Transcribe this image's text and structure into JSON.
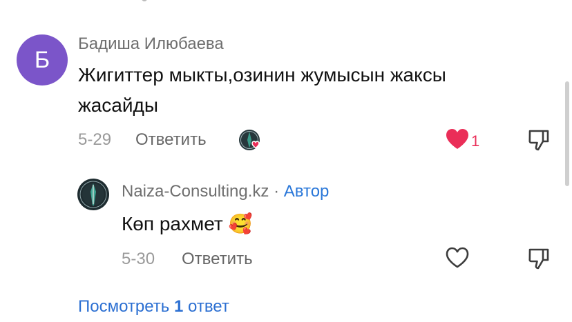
{
  "comment": {
    "avatar_letter": "Б",
    "author": "Бадиша Илюбаева",
    "text_line1": "Жигиттер мыкты,озинин жумысын жаксы",
    "text_line2": "жасайды",
    "date": "5-29",
    "reply_label": "Ответить",
    "like_count": "1",
    "liked": true,
    "colors": {
      "avatar": "#7b55c9",
      "like": "#ea2e58",
      "link": "#2b6fd2"
    }
  },
  "reply": {
    "author": "Naiza-Consulting.kz",
    "separator": " · ",
    "author_tag": "Автор",
    "text": "Көп рахмет",
    "emoji": "🥰",
    "date": "5-30",
    "reply_label": "Ответить"
  },
  "view_replies": {
    "prefix": "Посмотреть ",
    "count": "1",
    "suffix": " ответ"
  },
  "icons": [
    "heart-filled-icon",
    "heart-outline-icon",
    "dislike-icon",
    "creator-liked-avatar-icon",
    "spear-logo-avatar-icon"
  ]
}
